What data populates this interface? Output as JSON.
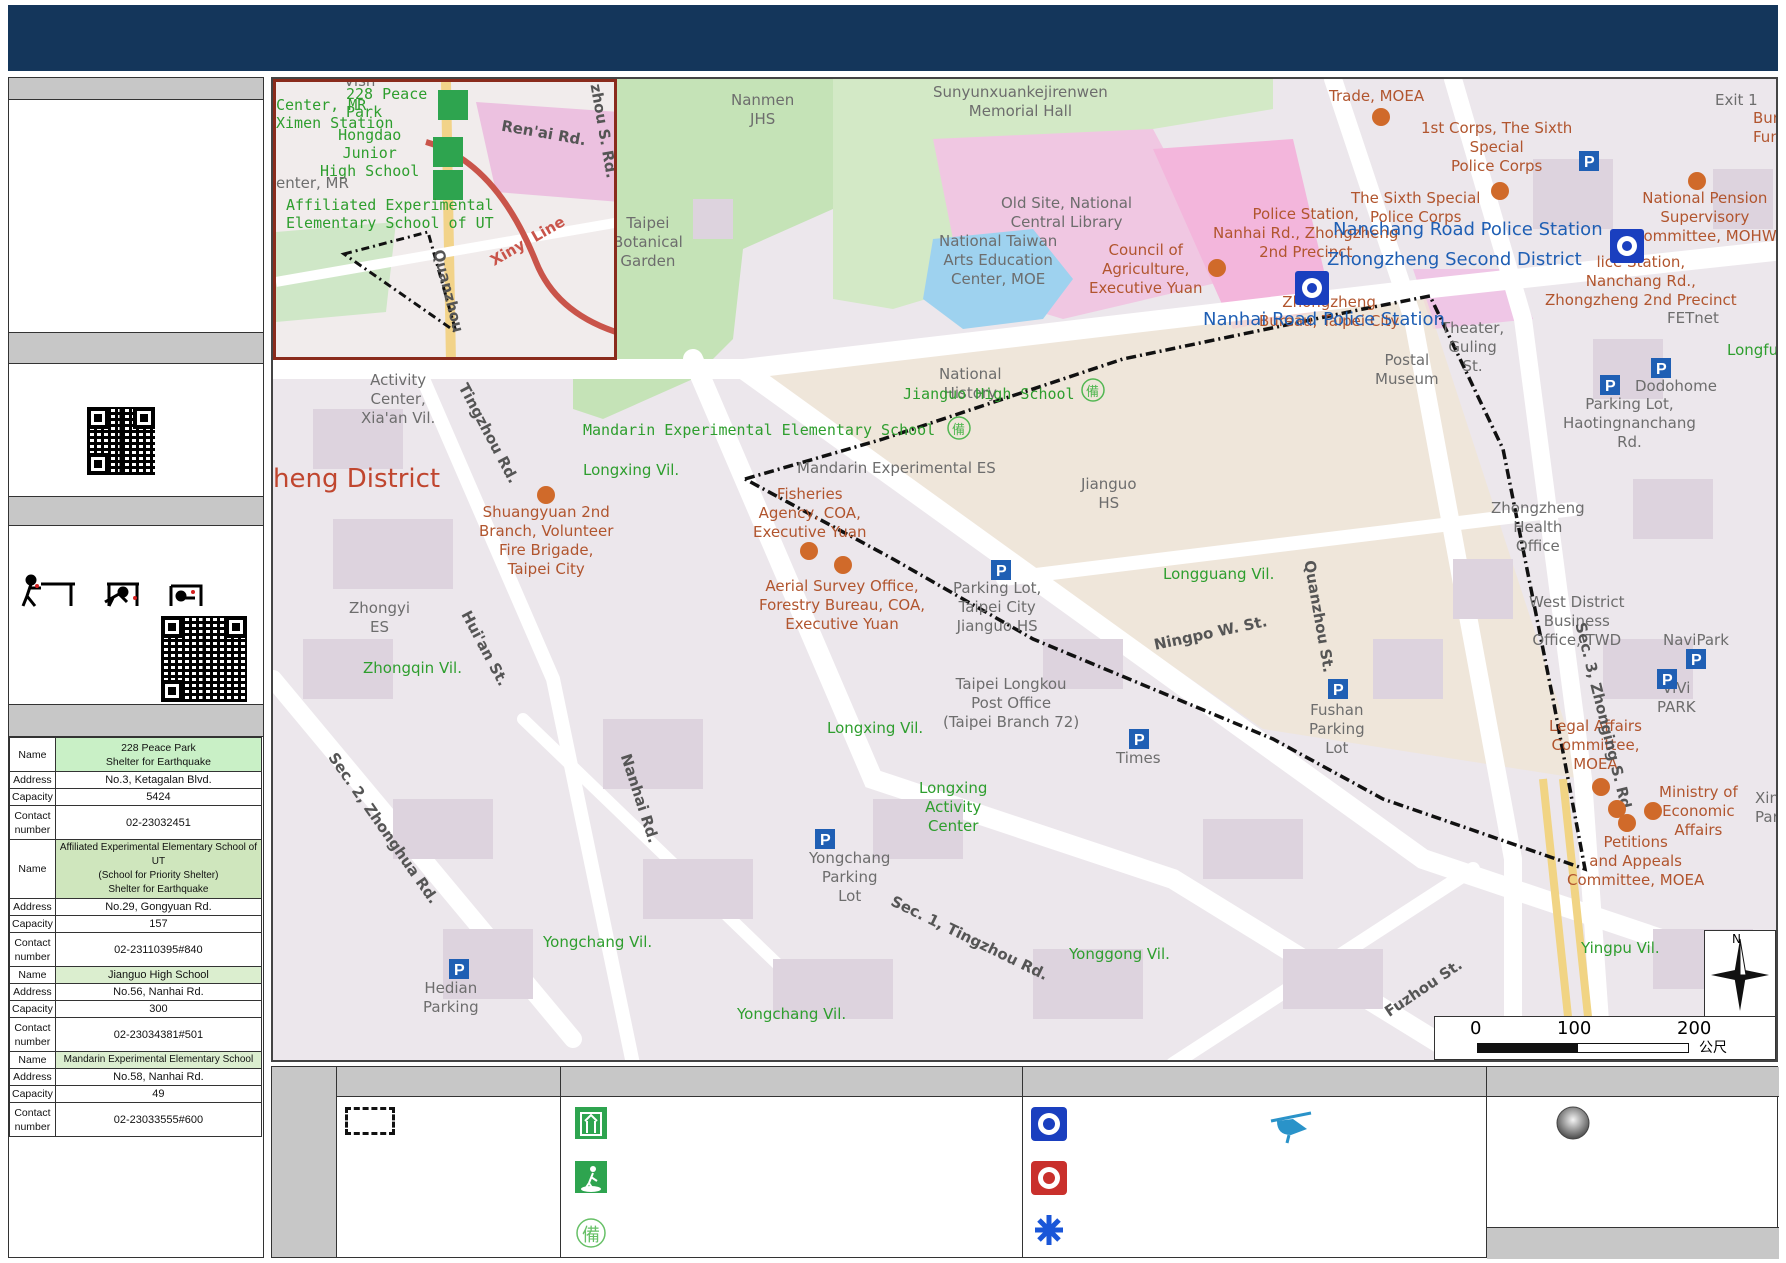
{
  "left_panel": {
    "shelters": [
      {
        "name_key": "Name",
        "name": "228 Peace Park\nShelter for Earthquake",
        "address_key": "Address",
        "address": "No.3, Ketagalan Blvd.",
        "capacity_key": "Capacity",
        "capacity": "5424",
        "contact_key": "Contact\nnumber",
        "contact": "02-23032451"
      },
      {
        "name_key": "Name",
        "name": "Affiliated Experimental Elementary School of UT\n(School for Priority Shelter)\nShelter for Earthquake",
        "address_key": "Address",
        "address": "No.29, Gongyuan Rd.",
        "capacity_key": "Capacity",
        "capacity": "157",
        "contact_key": "Contact\nnumber",
        "contact": "02-23110395#840"
      },
      {
        "name_key": "Name",
        "name": "Jianguo High School",
        "address_key": "Address",
        "address": "No.56, Nanhai Rd.",
        "capacity_key": "Capacity",
        "capacity": "300",
        "contact_key": "Contact\nnumber",
        "contact": "02-23034381#501"
      },
      {
        "name_key": "Name",
        "name": "Mandarin Experimental Elementary School",
        "address_key": "Address",
        "address": "No.58, Nanhai Rd.",
        "capacity_key": "Capacity",
        "capacity": "49",
        "contact_key": "Contact\nnumber",
        "contact": "02-23033555#600"
      }
    ]
  },
  "map": {
    "district": "heng District",
    "scale": {
      "t0": "0",
      "t1": "100",
      "t2": "200",
      "unit": "公尺"
    },
    "north": "N",
    "police_labels": {
      "nanchang": "Nanchang Road Police Station",
      "zhongzheng2": "Zhongzheng Second District",
      "nanhai": "Nanhai Road Police Station"
    },
    "labels": {
      "nanmen": "Nanmen\nJHS",
      "sunyun": "Sunyunxuankejirenwen\nMemorial Hall",
      "trade": "Trade, MOEA",
      "firstcorps": "1st Corps, The Sixth\nSpecial\nPolice Corps",
      "sixthcorps": "The Sixth Special\nPolice Corps",
      "pension": "National Pension\nSupervisory\nCommittee, MOHW",
      "exit": "Exit 1",
      "oldsite": "Old Site, National\nCentral Library",
      "ntaec": "National Taiwan\nArts Education\nCenter, MOE",
      "council": "Council of\nAgriculture,\nExecutive Yuan",
      "psnanhai": "Police Station,\nNanhai Rd., Zhongzheng\n2nd Precinct",
      "psnanchang": "lice Station,\nNanchang Rd.,\nZhongzheng 2nd Precinct",
      "fetnet": "FETnet",
      "zzbureau": "Zhongzheng\nBureau, Taipei City",
      "theater": "Theater,\nGuling\nSt.",
      "postal": "Postal\nMuseum",
      "longfu": "Longfu",
      "dodohome": "Dodohome",
      "parkinghtn": "Parking Lot,\nHaotingnanchang\nRd.",
      "botanical": "Taipei\nBotanical\nGarden",
      "activity": "Activity\nCenter,\nXia'an Vil.",
      "nathistory": "National\nHistory",
      "jianguohs": "Jianguo High School",
      "mandarinexp": "Mandarin Experimental Elementary School",
      "longxing1": "Longxing Vil.",
      "mandarines": "Mandarin Experimental ES",
      "jianguohs2": "Jianguo\nHS",
      "fisheries": "Fisheries\nAgency, COA,\nExecutive Yuan",
      "shuangyuan": "Shuangyuan 2nd\nBranch, Volunteer\nFire Brigade,\nTaipei City",
      "aerial": "Aerial Survey Office,\nForestry Bureau, COA,\nExecutive Yuan",
      "parkjg": "Parking Lot,\nTaipei City\nJianguo HS",
      "longguang": "Longguang Vil.",
      "zzhealth": "Zhongzheng\nHealth\nOffice",
      "westdist": "West District\nBusiness\nOffice, TWD",
      "navipark": "NaviPark",
      "vivi": "ViVi\nPARK",
      "zhongyi": "Zhongyi\nES",
      "zhongqin": "Zhongqin Vil.",
      "postoffice": "Taipei Longkou\nPost Office\n(Taipei Branch 72)",
      "fushan": "Fushan\nParking\nLot",
      "legal": "Legal Affairs\nCommittee,\nMOEA",
      "ministry": "Ministry of\nEconomic\nAffairs",
      "petitions": "Petitions\nand Appeals\nCommittee, MOEA",
      "xin": "Xin\nPar",
      "longxing2": "Longxing Vil.",
      "times": "Times",
      "lxactivity": "Longxing\nActivity\nCenter",
      "yongchangpk": "Yongchang\nParking\nLot",
      "yongchang1": "Yongchang Vil.",
      "yonggong": "Yonggong Vil.",
      "yingpu": "Yingpu Vil.",
      "hedian": "Hedian\nParking",
      "yongchang2": "Yongchang Vil.",
      "bur": "Bur\nFun"
    },
    "roads": {
      "ningpo": "Ningpo W. St.",
      "quanzhou": "Quanzhou St.",
      "zhonging": "Sec. 3, Zhonging S. Rd.",
      "tingzhou2": "Tingzhou Rd.",
      "huian": "Hui'an St.",
      "nanhai": "Nanhai Rd.",
      "zhonghua": "Sec. 2, Zhonghua Rd.",
      "tingzhou1": "Sec. 1, Tingzhou Rd.",
      "fuzhou": "Fuzhou St."
    },
    "inset": {
      "peace": "228 Peace\nPark",
      "ximen": "Center, MR\nXimen Station",
      "hongdao": "Hongdao\nJunior\nHigh School",
      "enter": "enter, MR",
      "renai": "Ren'ai Rd.",
      "zhou": "zhou S. Rd.",
      "affiliated": "Affiliated Experimental\nElementary School of UT",
      "xinyi": "Xinyi Line",
      "quanzhou": "Quanzhou",
      "vish": "Vish"
    }
  },
  "colors": {
    "header": "#14365b",
    "section_grey": "#c7c7c7",
    "inset_border": "#8a2b1c",
    "boundary": "#111111",
    "shelter_green": "#2ea44f",
    "police_blue": "#1a3fbf",
    "fire_red": "#c9302c"
  },
  "icons": [
    "shelter-earthquake-icon",
    "priority-shelter-icon",
    "reserve-shelter-icon",
    "police-icon",
    "fire-station-icon",
    "ambulance-icon",
    "helicopter-icon",
    "assembly-point-icon",
    "qr-code-icon",
    "drop-cover-hold-icon"
  ]
}
